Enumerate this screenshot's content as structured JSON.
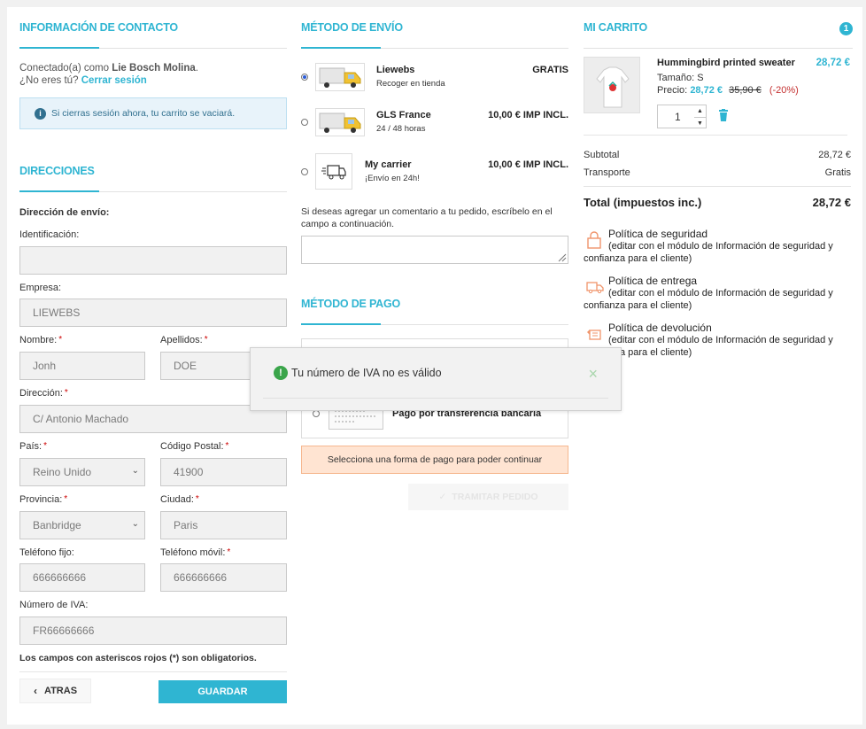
{
  "contact": {
    "title": "INFORMACIÓN DE CONTACTO",
    "connected_prefix": "Conectado(a) como",
    "user_name": "Lie Bosch Molina",
    "period": ".",
    "not_you": "¿No eres tú?",
    "logout_link": "Cerrar sesión",
    "info_text": "Si cierras sesión ahora, tu carrito se vaciará.",
    "info_icon": "i"
  },
  "addresses": {
    "title": "DIRECCIONES",
    "shipping_heading": "Dirección de envío:",
    "fields": {
      "alias": {
        "label": "Identificación:",
        "value": ""
      },
      "company": {
        "label": "Empresa:",
        "value": "LIEWEBS"
      },
      "firstname": {
        "label": "Nombre:",
        "value": "Jonh"
      },
      "lastname": {
        "label": "Apellidos:",
        "value": "DOE"
      },
      "address": {
        "label": "Dirección:",
        "value": "C/ Antonio Machado"
      },
      "country": {
        "label": "País:",
        "value": "Reino Unido"
      },
      "postcode": {
        "label": "Código Postal:",
        "value": "41900"
      },
      "state": {
        "label": "Provincia:",
        "value": "Banbridge"
      },
      "city": {
        "label": "Ciudad:",
        "value": "Paris"
      },
      "phone": {
        "label": "Teléfono fijo:",
        "value": "666666666"
      },
      "mobile": {
        "label": "Teléfono móvil:",
        "value": "666666666"
      },
      "vat": {
        "label": "Número de IVA:",
        "value": "FR66666666"
      }
    },
    "required_mark": "*",
    "required_note": "Los campos con asteriscos rojos (*) son obligatorios.",
    "back_label": "ATRAS",
    "save_label": "GUARDAR"
  },
  "shipping": {
    "title": "MÉTODO DE ENVÍO",
    "carriers": [
      {
        "name": "Liewebs",
        "delay": "Recoger en tienda",
        "price": "GRATIS",
        "checked": true
      },
      {
        "name": "GLS France",
        "delay": "24 / 48 horas",
        "price": "10,00 € IMP INCL.",
        "checked": false
      },
      {
        "name": "My carrier",
        "delay": "¡Envío en 24h!",
        "price": "10,00 € IMP INCL.",
        "checked": false
      }
    ],
    "comment_prompt": "Si deseas agregar un comentario a tu pedido, escríbelo en el campo a continuación."
  },
  "payment": {
    "title": "MÉTODO DE PAGO",
    "option_label": "Pago por transferencia bancaria",
    "warning": "Selecciona una forma de pago para poder continuar",
    "submit_label": "TRAMITAR PEDIDO"
  },
  "cart": {
    "title": "MI CARRITO",
    "count": "1",
    "product": {
      "name": "Hummingbird printed sweater",
      "price": "28,72 €",
      "size_label": "Tamaño:",
      "size_value": "S",
      "price_label": "Precio:",
      "unit_price": "28,72 €",
      "old_price": "35,90 €",
      "discount": "(-20%)",
      "quantity": "1"
    },
    "subtotal_label": "Subtotal",
    "subtotal_value": "28,72 €",
    "shipping_label": "Transporte",
    "shipping_value": "Gratis",
    "total_label": "Total (impuestos inc.)",
    "total_value": "28,72 €"
  },
  "reassurance": [
    {
      "icon": "lock-icon",
      "title": "Política de seguridad",
      "desc": "(editar con el módulo de Información de seguridad y confianza para el cliente)"
    },
    {
      "icon": "truck-icon",
      "title": "Política de entrega",
      "desc": "(editar con el módulo de Información de seguridad y confianza para el cliente)"
    },
    {
      "icon": "return-icon",
      "title": "Política de devolución",
      "desc": "(editar con el módulo de Información de seguridad y confianza para el cliente)"
    }
  ],
  "notification": {
    "text": "Tu número de IVA no es válido",
    "icon": "!",
    "close": "×"
  },
  "colors": {
    "accent": "#2fb5d2",
    "warning_bg": "#ffe4d2",
    "success": "#3aa54a",
    "info_bg": "#e8f3fa"
  }
}
